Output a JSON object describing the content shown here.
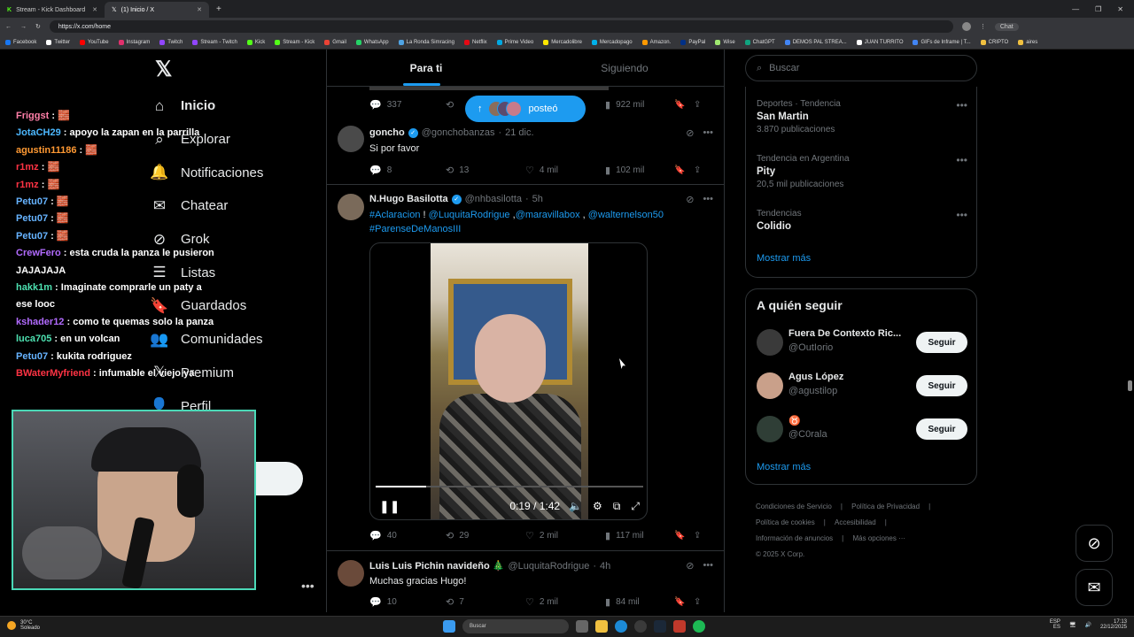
{
  "browser": {
    "tabs": [
      {
        "label": "Stream - Kick Dashboard",
        "icon": "kick-icon"
      },
      {
        "label": "(1) Inicio / X",
        "icon": "x-icon"
      }
    ],
    "url": "https://x.com/home",
    "bookmarks": [
      "Facebook",
      "Twitter",
      "YouTube",
      "Instagram",
      "Twitch",
      "Stream - Twitch",
      "Kick",
      "Stream - Kick",
      "Gmail",
      "WhatsApp",
      "La Ronda Simracing",
      "Netflix",
      "Prime Video",
      "Mercadolibre",
      "Mercadopago",
      "Amazon.",
      "PayPal",
      "Wise",
      "ChatGPT",
      "DEMOS PAL STREA...",
      "JUAN TURRITO",
      "GIFs de Inframe | T...",
      "CRIPTO",
      "aires"
    ],
    "chat_label": "Chat"
  },
  "nav": {
    "items": [
      {
        "label": "Inicio",
        "icon": "home-icon"
      },
      {
        "label": "Explorar",
        "icon": "search-icon"
      },
      {
        "label": "Notificaciones",
        "icon": "bell-icon"
      },
      {
        "label": "Chatear",
        "icon": "mail-icon"
      },
      {
        "label": "Grok",
        "icon": "grok-icon"
      },
      {
        "label": "Listas",
        "icon": "list-icon"
      },
      {
        "label": "Guardados",
        "icon": "bookmark-icon"
      },
      {
        "label": "Comunidades",
        "icon": "people-icon"
      },
      {
        "label": "Premium",
        "icon": "x-icon"
      },
      {
        "label": "Perfil",
        "icon": "person-icon"
      }
    ]
  },
  "stream_chat": [
    {
      "user": "Friggst",
      "color": "#ff7fa8",
      "msg": "🧱"
    },
    {
      "user": "JotaCH29",
      "color": "#4db8ff",
      "msg": "apoyo la zapan en la parrilla"
    },
    {
      "user": "agustin11186",
      "color": "#ff9933",
      "msg": "🧱"
    },
    {
      "user": "r1mz",
      "color": "#ff3344",
      "msg": "🧱"
    },
    {
      "user": "r1mz",
      "color": "#ff3344",
      "msg": "🧱"
    },
    {
      "user": "Petu07",
      "color": "#66b3ff",
      "msg": "🧱"
    },
    {
      "user": "Petu07",
      "color": "#66b3ff",
      "msg": "🧱"
    },
    {
      "user": "Petu07",
      "color": "#66b3ff",
      "msg": "🧱"
    },
    {
      "user": "CrewFero",
      "color": "#b26bff",
      "msg": "esta cruda la panza le pusieron JAJAJAJA"
    },
    {
      "user": "hakk1m",
      "color": "#4de0b0",
      "msg": "Imaginate comprarle un paty a ese looc"
    },
    {
      "user": "kshader12",
      "color": "#b26bff",
      "msg": "como te quemas solo la panza"
    },
    {
      "user": "luca705",
      "color": "#4de0b0",
      "msg": "en un volcan"
    },
    {
      "user": "Petu07",
      "color": "#66b3ff",
      "msg": "kukita rodriguez"
    },
    {
      "user": "BWaterMyfriend",
      "color": "#ff3344",
      "msg": "infumable el viejo ya"
    }
  ],
  "feed": {
    "tabs": [
      "Para ti",
      "Siguiendo"
    ],
    "posted_pill": "posteó",
    "top_actions": {
      "replies": "337",
      "views": "922 mil"
    },
    "tweets": [
      {
        "name": "goncho",
        "handle": "@gonchobanzas",
        "time": "21 dic.",
        "text": "Si por favor",
        "replies": "8",
        "reposts": "13",
        "likes": "4 mil",
        "views": "102 mil"
      },
      {
        "name": "N.Hugo Basilotta",
        "handle": "@nhbasilotta",
        "time": "5h",
        "text_parts": [
          "#Aclaracion",
          " ! ",
          "@LuquitaRodrigue",
          " ,",
          "@maravillabox",
          " , ",
          "@walternelson50",
          "#ParenseDeManosIII"
        ],
        "video_time": "0:19 / 1:42",
        "video_progress": 0.19,
        "replies": "40",
        "reposts": "29",
        "likes": "2 mil",
        "views": "117 mil"
      },
      {
        "name": "Luis Luis Pichin navideño 🎄",
        "handle": "@LuquitaRodrigue",
        "time": "4h",
        "text": "Muchas gracias Hugo!",
        "replies": "10",
        "reposts": "7",
        "likes": "2 mil",
        "views": "84 mil"
      }
    ]
  },
  "sidebar": {
    "search_placeholder": "Buscar",
    "trends": [
      {
        "meta": "Deportes · Tendencia",
        "title": "San Martin",
        "count": "3.870 publicaciones"
      },
      {
        "meta": "Tendencia en Argentina",
        "title": "Pity",
        "count": "20,5 mil publicaciones"
      },
      {
        "meta": "Tendencias",
        "title": "Colidio",
        "count": ""
      }
    ],
    "show_more": "Mostrar más",
    "follow_title": "A quién seguir",
    "follow": [
      {
        "name": "Fuera De Contexto Ric...",
        "handle": "@OutIorio",
        "btn": "Seguir"
      },
      {
        "name": "Agus López",
        "handle": "@agustilop",
        "btn": "Seguir"
      },
      {
        "name": "♉",
        "handle": "@C0rala",
        "btn": "Seguir"
      }
    ],
    "footer": [
      "Condiciones de Servicio",
      "Política de Privacidad",
      "Política de cookies",
      "Accesibilidad",
      "Información de anuncios",
      "Más opciones ···",
      "© 2025 X Corp."
    ]
  },
  "taskbar": {
    "weather_temp": "30°C",
    "weather_desc": "Soleado",
    "search_placeholder": "Buscar",
    "lang": "ESP",
    "lang_sub": "ES",
    "time": "17:13",
    "date": "22/12/2025"
  }
}
